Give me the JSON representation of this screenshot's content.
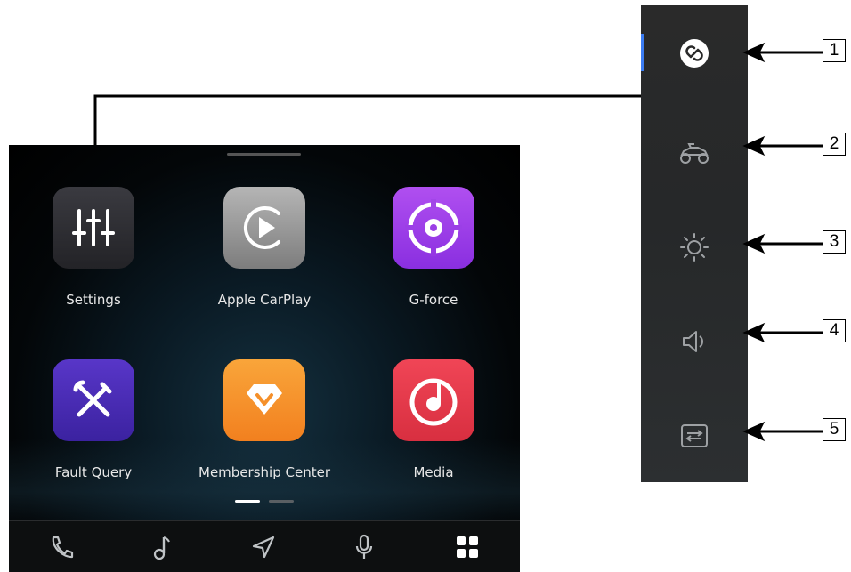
{
  "screen": {
    "apps": [
      {
        "label": "Settings",
        "icon": "sliders-icon"
      },
      {
        "label": "Apple CarPlay",
        "icon": "carplay-icon"
      },
      {
        "label": "G-force",
        "icon": "gforce-target-icon"
      },
      {
        "label": "Fault Query",
        "icon": "wrench-screwdriver-icon"
      },
      {
        "label": "Membership Center",
        "icon": "diamond-icon"
      },
      {
        "label": "Media",
        "icon": "music-disc-icon"
      }
    ],
    "page_indicator": {
      "pages": 2,
      "current": 1
    },
    "bottom_bar": [
      {
        "icon": "phone-icon"
      },
      {
        "icon": "music-note-icon"
      },
      {
        "icon": "navigation-icon"
      },
      {
        "icon": "microphone-icon"
      },
      {
        "icon": "app-grid-icon"
      }
    ]
  },
  "sidebar": {
    "items": [
      {
        "icon": "link-icon",
        "active": true
      },
      {
        "icon": "motorcycle-atv-icon"
      },
      {
        "icon": "brightness-icon"
      },
      {
        "icon": "volume-icon"
      },
      {
        "icon": "settings-toggle-icon"
      }
    ]
  },
  "callouts": [
    "1",
    "2",
    "3",
    "4",
    "5"
  ],
  "colors": {
    "accent_blue": "#3b7cf2",
    "carplay_gray": "#9a9a9a",
    "gforce_purple": "#9b3fe6",
    "fault_indigo": "#4a2bb8",
    "membership_orange": "#f5902a",
    "media_red": "#e8394a",
    "settings_dark": "#2e2e33"
  }
}
